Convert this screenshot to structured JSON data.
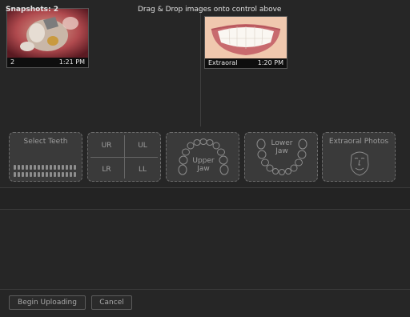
{
  "snapshots": [
    {
      "label": "2",
      "time": "1:21 PM"
    },
    {
      "label": "Extraoral",
      "time": "1:20 PM"
    }
  ],
  "tiles": {
    "select_teeth": "Select Teeth",
    "quadrants": {
      "ur": "UR",
      "ul": "UL",
      "lr": "LR",
      "ll": "LL"
    },
    "upper_jaw": "Upper Jaw",
    "lower_jaw": "Lower Jaw",
    "extraoral": "Extraoral Photos"
  },
  "info": {
    "snapshots_label": "Snapshots: 2",
    "drop_hint": "Drag & Drop images onto control above"
  },
  "footer": {
    "upload_label": "Begin Uploading",
    "cancel_label": "Cancel"
  },
  "colors": {
    "background": "#262626",
    "tile": "#3a3a3a"
  }
}
